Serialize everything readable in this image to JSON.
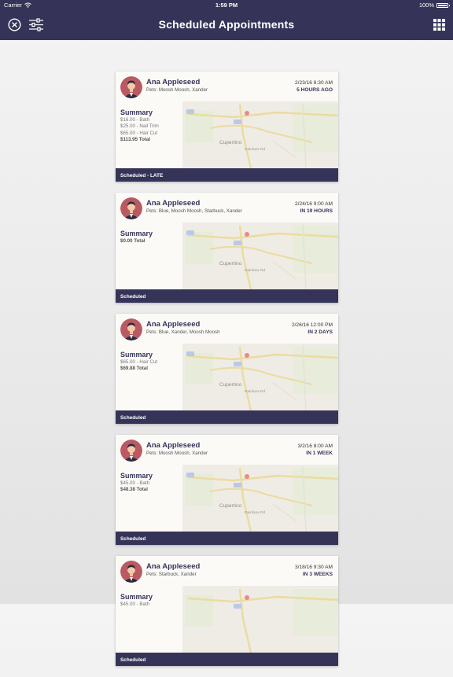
{
  "status_bar": {
    "carrier": "Carrier",
    "time": "1:59 PM",
    "battery": "100%"
  },
  "header": {
    "title": "Scheduled Appointments",
    "left_icons": [
      "close-icon",
      "filter-sliders-icon"
    ],
    "right_icon": "grid-icon"
  },
  "map_labels": {
    "city": "Cupertino",
    "road": "Rainbow Rd"
  },
  "colors": {
    "brand": "#353458"
  },
  "appointments": [
    {
      "client": "Ana Appleseed",
      "pets": "Pets: Moosh Moosh, Xander",
      "date": "2/23/16 8:30 AM",
      "relative": "5 HOURS AGO",
      "summary_title": "Summary",
      "line_items": [
        "$16.00 - Bath",
        "$25.00 - Nail Trim",
        "$65.00 - Hair Cut"
      ],
      "total": "$113.95 Total",
      "status": "Scheduled - LATE"
    },
    {
      "client": "Ana Appleseed",
      "pets": "Pets: Blue, Moosh Moosh, Starbuck, Xander",
      "date": "2/24/16 9:00 AM",
      "relative": "IN 19 HOURS",
      "summary_title": "Summary",
      "line_items": [],
      "total": "$0.00 Total",
      "status": "Scheduled"
    },
    {
      "client": "Ana Appleseed",
      "pets": "Pets: Blue, Xander, Moosh Moosh",
      "date": "2/26/16 12:00 PM",
      "relative": "IN 2 DAYS",
      "summary_title": "Summary",
      "line_items": [
        "$65.00 - Hair Cut"
      ],
      "total": "$69.88 Total",
      "status": "Scheduled"
    },
    {
      "client": "Ana Appleseed",
      "pets": "Pets: Moosh Moosh, Xander",
      "date": "3/2/16 8:00 AM",
      "relative": "IN 1 WEEK",
      "summary_title": "Summary",
      "line_items": [
        "$45.00 - Bath"
      ],
      "total": "$48.38 Total",
      "status": "Scheduled"
    },
    {
      "client": "Ana Appleseed",
      "pets": "Pets: Starbuck, Xander",
      "date": "3/18/16 9:30 AM",
      "relative": "IN 3 WEEKS",
      "summary_title": "Summary",
      "line_items": [
        "$45.00 - Bath"
      ],
      "total": "",
      "status": "Scheduled"
    }
  ]
}
